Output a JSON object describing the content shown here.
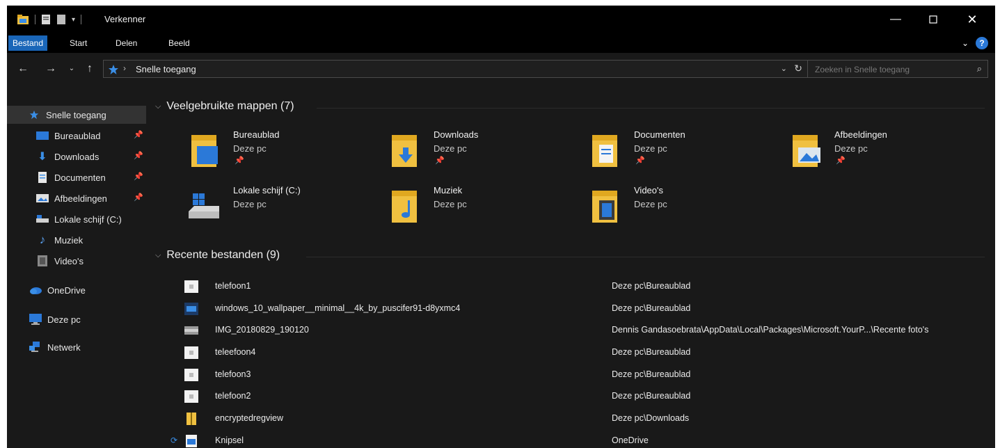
{
  "window": {
    "title": "Verkenner"
  },
  "ribbon": {
    "tabs": [
      "Bestand",
      "Start",
      "Delen",
      "Beeld"
    ],
    "active": "Bestand",
    "help": "?"
  },
  "address": {
    "path": "Snelle toegang",
    "search_placeholder": "Zoeken in Snelle toegang"
  },
  "sidebar": {
    "items": [
      {
        "label": "Snelle toegang",
        "icon": "star-icon",
        "pinned": false,
        "selected": true
      },
      {
        "label": "Bureaublad",
        "icon": "desktop-icon",
        "pinned": true
      },
      {
        "label": "Downloads",
        "icon": "download-icon",
        "pinned": true
      },
      {
        "label": "Documenten",
        "icon": "document-icon",
        "pinned": true
      },
      {
        "label": "Afbeeldingen",
        "icon": "image-icon",
        "pinned": true
      },
      {
        "label": "Lokale schijf (C:)",
        "icon": "drive-icon",
        "pinned": false
      },
      {
        "label": "Muziek",
        "icon": "music-icon",
        "pinned": false
      },
      {
        "label": "Video's",
        "icon": "video-icon",
        "pinned": false
      },
      {
        "label": "OneDrive",
        "icon": "cloud-icon",
        "pinned": false
      },
      {
        "label": "Deze pc",
        "icon": "computer-icon",
        "pinned": false
      },
      {
        "label": "Netwerk",
        "icon": "network-icon",
        "pinned": false
      }
    ]
  },
  "frequent": {
    "header": "Veelgebruikte mappen (7)",
    "folders": [
      {
        "name": "Bureaublad",
        "location": "Deze pc",
        "pinned": true,
        "icon": "desktop-folder-icon"
      },
      {
        "name": "Downloads",
        "location": "Deze pc",
        "pinned": true,
        "icon": "downloads-folder-icon"
      },
      {
        "name": "Documenten",
        "location": "Deze pc",
        "pinned": true,
        "icon": "documents-folder-icon"
      },
      {
        "name": "Afbeeldingen",
        "location": "Deze pc",
        "pinned": true,
        "icon": "pictures-folder-icon"
      },
      {
        "name": "Lokale schijf (C:)",
        "location": "Deze pc",
        "pinned": false,
        "icon": "drive-icon"
      },
      {
        "name": "Muziek",
        "location": "Deze pc",
        "pinned": false,
        "icon": "music-folder-icon"
      },
      {
        "name": "Video's",
        "location": "Deze pc",
        "pinned": false,
        "icon": "videos-folder-icon"
      }
    ]
  },
  "recent": {
    "header": "Recente bestanden (9)",
    "files": [
      {
        "name": "telefoon1",
        "location": "Deze pc\\Bureaublad",
        "icon": "image-file-icon"
      },
      {
        "name": "windows_10_wallpaper__minimal__4k_by_puscifer91-d8yxmc4",
        "location": "Deze pc\\Bureaublad",
        "icon": "image-file-icon"
      },
      {
        "name": "IMG_20180829_190120",
        "location": "Dennis Gandasoebrata\\AppData\\Local\\Packages\\Microsoft.YourP...\\Recente foto's",
        "icon": "image-file-icon"
      },
      {
        "name": "teleefoon4",
        "location": "Deze pc\\Bureaublad",
        "icon": "image-file-icon"
      },
      {
        "name": "telefoon3",
        "location": "Deze pc\\Bureaublad",
        "icon": "image-file-icon"
      },
      {
        "name": "telefoon2",
        "location": "Deze pc\\Bureaublad",
        "icon": "image-file-icon"
      },
      {
        "name": "encryptedregview",
        "location": "Deze pc\\Downloads",
        "icon": "zip-folder-icon"
      },
      {
        "name": "Knipsel",
        "location": "OneDrive",
        "icon": "image-file-icon",
        "sync": true
      }
    ]
  },
  "colors": {
    "background": "#191919",
    "accent": "#1a66b8",
    "folder": "#f0c040"
  }
}
